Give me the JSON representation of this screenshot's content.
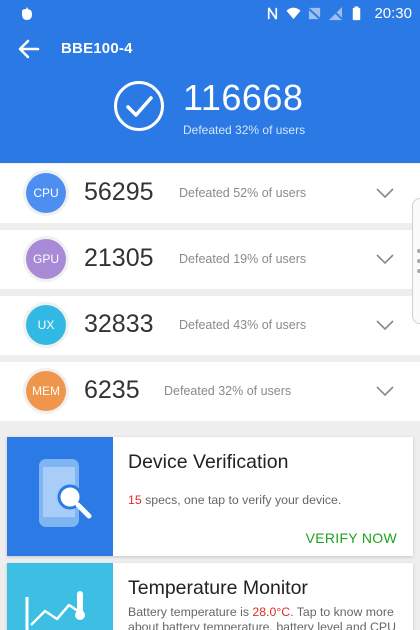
{
  "status_bar": {
    "time": "20:30",
    "icons": [
      "app-icon",
      "nfc-icon",
      "wifi-icon",
      "no-sim-icon",
      "no-signal-icon",
      "battery-icon"
    ]
  },
  "header": {
    "device_name": "BBE100-4",
    "total_score": "116668",
    "total_defeated": "Defeated 32% of users",
    "background_color": "#2a79e4"
  },
  "scores": [
    {
      "badge": "CPU",
      "score": "56295",
      "defeated": "Defeated 52% of users",
      "color": "#4d8ff0"
    },
    {
      "badge": "GPU",
      "score": "21305",
      "defeated": "Defeated 19% of users",
      "color": "#a98ad6"
    },
    {
      "badge": "UX",
      "score": "32833",
      "defeated": "Defeated 43% of users",
      "color": "#32b9e3"
    },
    {
      "badge": "MEM",
      "score": "6235",
      "defeated": "Defeated 32% of users",
      "color": "#f0954c"
    }
  ],
  "device_verification": {
    "title": "Device Verification",
    "specs_count": "15",
    "desc_suffix": " specs, one tap to verify your device.",
    "action_label": "VERIFY NOW"
  },
  "temperature_monitor": {
    "title": "Temperature Monitor",
    "desc_prefix": "Battery temperature is ",
    "temperature": "28.0°C",
    "desc_suffix": ". Tap to know more about battery temperature, battery level and CPU"
  }
}
